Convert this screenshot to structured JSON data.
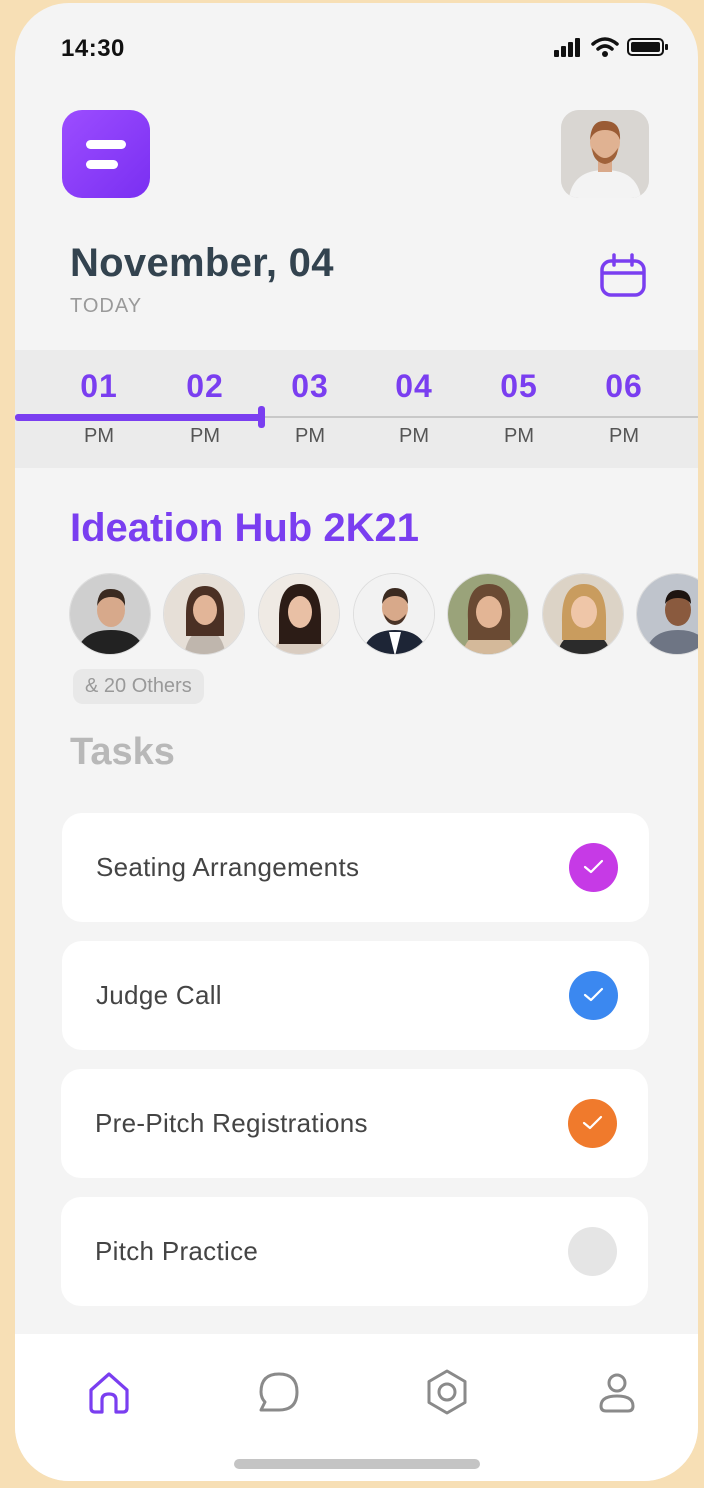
{
  "status_bar": {
    "time": "14:30"
  },
  "header": {
    "date": "November, 04",
    "subtitle": "TODAY"
  },
  "timeline": {
    "hours": [
      {
        "num": "01",
        "ampm": "PM"
      },
      {
        "num": "02",
        "ampm": "PM"
      },
      {
        "num": "03",
        "ampm": "PM"
      },
      {
        "num": "04",
        "ampm": "PM"
      },
      {
        "num": "05",
        "ampm": "PM"
      },
      {
        "num": "06",
        "ampm": "PM"
      }
    ],
    "progress": 0.36
  },
  "event": {
    "title": "Ideation Hub 2K21",
    "others_label": "& 20 Others"
  },
  "tasks_title": "Tasks",
  "tasks": [
    {
      "label": "Seating Arrangements",
      "done": true,
      "color": "#c63ae6"
    },
    {
      "label": "Judge Call",
      "done": true,
      "color": "#3b88f0"
    },
    {
      "label": "Pre-Pitch Registrations",
      "done": true,
      "color": "#f07a2c"
    },
    {
      "label": "Pitch Practice",
      "done": false,
      "color": "#e5e5e5"
    }
  ],
  "nav": [
    {
      "icon": "home-icon",
      "active": true
    },
    {
      "icon": "chat-icon",
      "active": false
    },
    {
      "icon": "settings-icon",
      "active": false
    },
    {
      "icon": "profile-icon",
      "active": false
    }
  ],
  "colors": {
    "accent": "#7a3ef0",
    "background": "#f4f4f4",
    "frame": "#f7dfb5"
  }
}
